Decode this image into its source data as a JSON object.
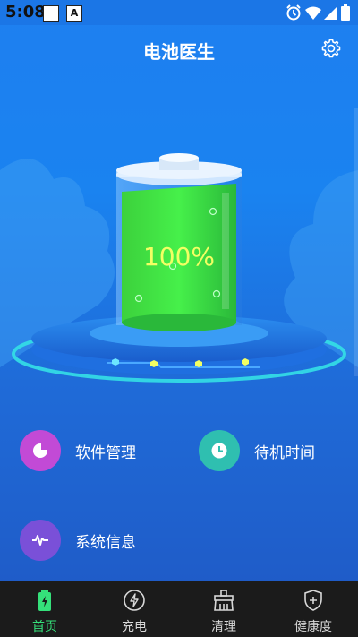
{
  "status_bar": {
    "time": "5:08",
    "notif_a": "A"
  },
  "app_bar": {
    "title": "电池医生"
  },
  "battery": {
    "percent_label": "100%",
    "level": 1.0
  },
  "features": [
    {
      "label": "软件管理",
      "icon": "pie-chart-icon",
      "color": "#c24ad6"
    },
    {
      "label": "待机时间",
      "icon": "clock-icon",
      "color": "#2fbfb0"
    },
    {
      "label": "系统信息",
      "icon": "pulse-icon",
      "color": "#7a50d8"
    }
  ],
  "tabs": [
    {
      "label": "首页",
      "icon": "battery-icon",
      "active": true
    },
    {
      "label": "充电",
      "icon": "charge-bolt-icon",
      "active": false
    },
    {
      "label": "清理",
      "icon": "broom-icon",
      "active": false
    },
    {
      "label": "健康度",
      "icon": "shield-plus-icon",
      "active": false
    }
  ],
  "colors": {
    "accent_green": "#35e07a",
    "bg_blue": "#1e7ff0",
    "percent_yellow": "#f2ff63"
  }
}
